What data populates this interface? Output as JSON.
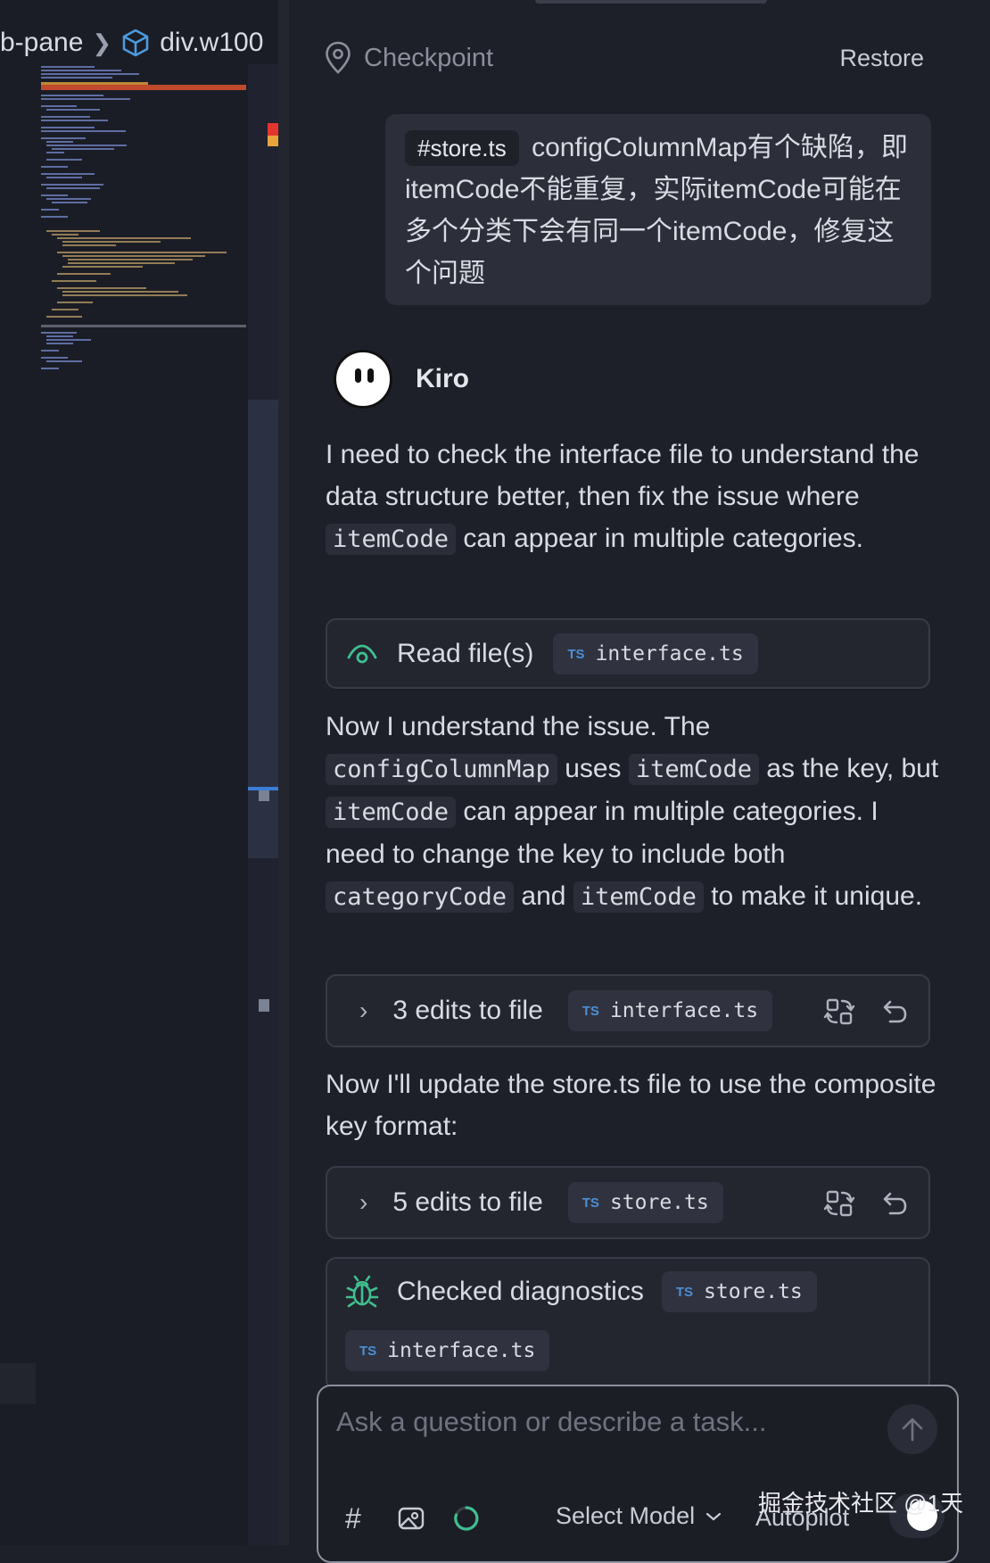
{
  "editor": {
    "breadcrumb": {
      "segment1": "b-pane",
      "segment2": "div.w100"
    }
  },
  "checkpoint": {
    "label": "Checkpoint",
    "restore_label": "Restore"
  },
  "user_message": {
    "tag": "#store.ts",
    "text": "configColumnMap有个缺陷，即itemCode不能重复，实际itemCode可能在多个分类下会有同一个itemCode，修复这个问题"
  },
  "assistant": {
    "name": "Kiro",
    "para1": {
      "t1": "I need to check the interface file to understand the data structure better, then fix the issue where",
      "c1": "itemCode",
      "t2": "can appear in multiple categories."
    },
    "read_card": {
      "label": "Read file(s)",
      "file": "interface.ts",
      "file_badge": "TS"
    },
    "para2": {
      "t1": "Now I understand the issue. The",
      "c1": "configColumnMap",
      "t2": "uses",
      "c2": "itemCode",
      "t3": "as the key, but",
      "c3": "itemCode",
      "t4": "can appear in multiple categories. I need to change the key to include both",
      "c4": "categoryCode",
      "t5": "and",
      "c5": "itemCode",
      "t6": "to make it unique."
    },
    "edit_card_1": {
      "label": "3 edits to file",
      "file": "interface.ts",
      "file_badge": "TS"
    },
    "para3": {
      "text": "Now I'll update the store.ts file to use the composite key format:"
    },
    "edit_card_2": {
      "label": "5 edits to file",
      "file": "store.ts",
      "file_badge": "TS"
    },
    "diagnostics_card": {
      "label": "Checked diagnostics",
      "file1": "store.ts",
      "file2": "interface.ts",
      "file_badge": "TS"
    }
  },
  "composer": {
    "placeholder": "Ask a question or describe a task...",
    "hash_label": "#",
    "select_model_label": "Select Model",
    "autopilot_label": "Autopilot"
  },
  "watermark": "掘金技术社区 @1天",
  "colors": {
    "background": "#1e2029",
    "accent_green": "#3fbf8f",
    "ts_blue": "#4b8fd6"
  }
}
